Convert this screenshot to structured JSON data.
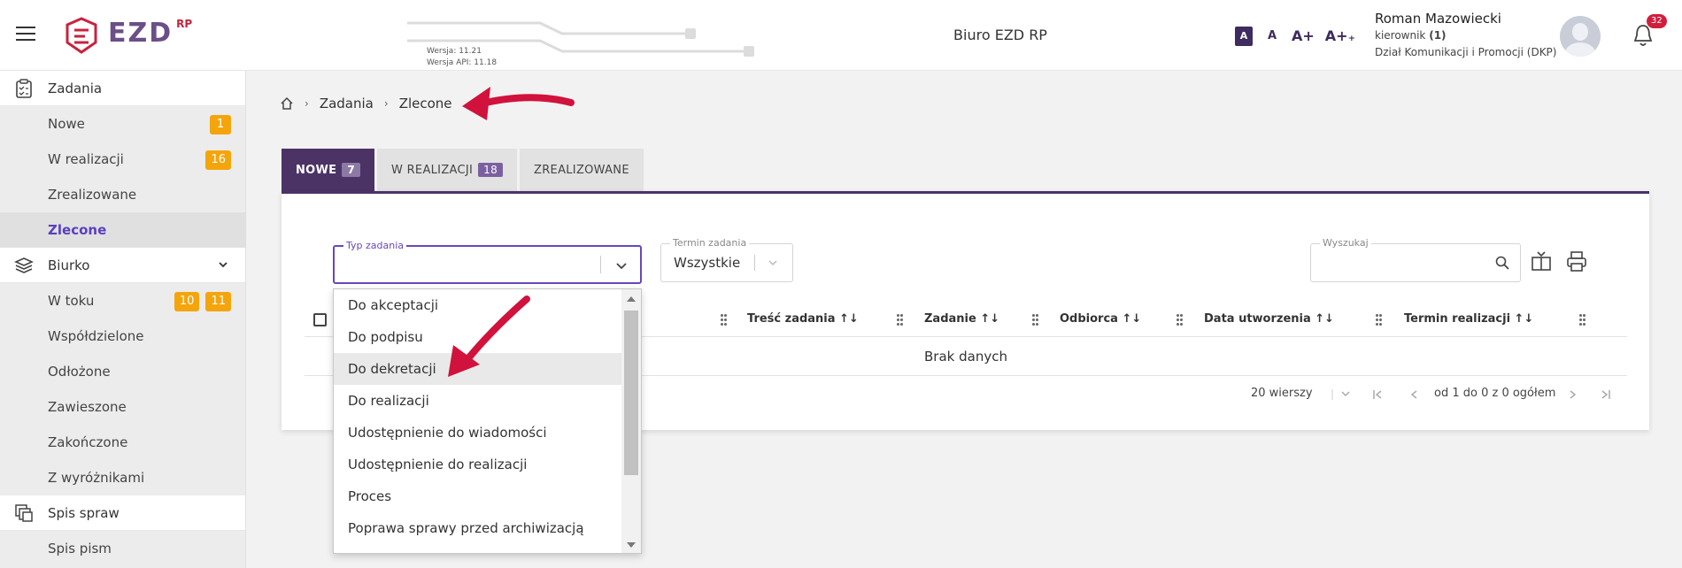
{
  "header": {
    "logo_text": "EZD",
    "logo_sup": "RP",
    "version": "Wersja: 11.21",
    "version_api": "Wersja API: 11.18",
    "office": "Biuro EZD RP",
    "font_sizes": [
      "A",
      "A",
      "A+",
      "A+₊"
    ],
    "user": {
      "name": "Roman Mazowiecki",
      "role": "kierownik",
      "role_count": "(1)",
      "department": "Dział Komunikacji i Promocji (DKP)"
    },
    "notifications": "32"
  },
  "sidebar": {
    "zadania": {
      "label": "Zadania",
      "items": [
        {
          "label": "Nowe",
          "badges": [
            "1"
          ]
        },
        {
          "label": "W realizacji",
          "badges": [
            "16"
          ]
        },
        {
          "label": "Zrealizowane",
          "badges": []
        },
        {
          "label": "Zlecone",
          "badges": []
        }
      ]
    },
    "biurko": {
      "label": "Biurko",
      "items": [
        {
          "label": "W toku",
          "badges": [
            "10",
            "11"
          ]
        },
        {
          "label": "Współdzielone"
        },
        {
          "label": "Odłożone"
        },
        {
          "label": "Zawieszone"
        },
        {
          "label": "Zakończone"
        },
        {
          "label": "Z wyróżnikami"
        }
      ]
    },
    "spis_spraw": "Spis spraw",
    "spis_pism": "Spis pism"
  },
  "breadcrumb": [
    "Zadania",
    "Zlecone"
  ],
  "tabs": [
    {
      "label": "NOWE",
      "count": "7"
    },
    {
      "label": "W REALIZACJI",
      "count": "18"
    },
    {
      "label": "ZREALIZOWANE"
    }
  ],
  "filters": {
    "typ_label": "Typ zadania",
    "termin_label": "Termin zadania",
    "termin_value": "Wszystkie",
    "search_label": "Wyszukaj"
  },
  "table": {
    "columns": [
      "Treść zadania",
      "Zadanie",
      "Odbiorca",
      "Data utworzenia",
      "Termin realizacji"
    ],
    "empty": "Brak danych"
  },
  "paging": {
    "rows": "20 wierszy",
    "range": "od 1 do 0 z 0 ogółem"
  },
  "dropdown": [
    "Do akceptacji",
    "Do podpisu",
    "Do dekretacji",
    "Do realizacji",
    "Udostępnienie do wiadomości",
    "Udostępnienie do realizacji",
    "Proces",
    "Poprawa sprawy przed archiwizacją"
  ],
  "colors": {
    "primary": "#4b3366",
    "accent": "#6848b8",
    "badge": "#f4a50c",
    "alert": "#d01f3c"
  }
}
